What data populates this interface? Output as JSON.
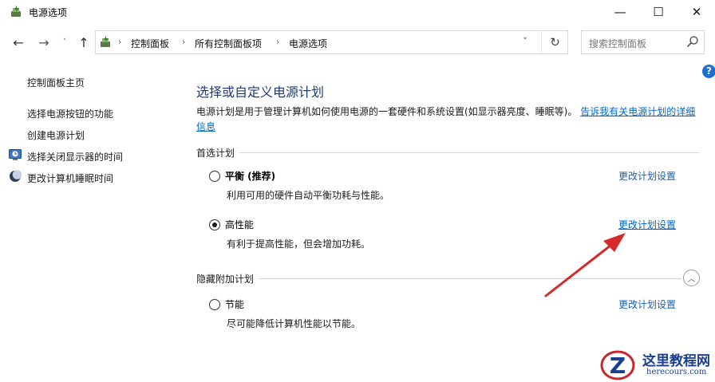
{
  "window": {
    "title": "电源选项",
    "minimize_glyph": "—",
    "maximize_glyph": "☐",
    "close_glyph": "✕"
  },
  "nav": {
    "back_glyph": "←",
    "forward_glyph": "→",
    "recent_glyph": "˅",
    "up_glyph": "↑",
    "breadcrumb": [
      "控制面板",
      "所有控制面板项",
      "电源选项"
    ],
    "dropdown_glyph": "˅",
    "refresh_glyph": "↻"
  },
  "search": {
    "placeholder": "搜索控制面板"
  },
  "help_glyph": "?",
  "sidebar": {
    "home": "控制面板主页",
    "links": [
      "选择电源按钮的功能",
      "创建电源计划",
      "选择关闭显示器的时间",
      "更改计算机睡眠时间"
    ]
  },
  "main": {
    "heading": "选择或自定义电源计划",
    "description": "电源计划是用于管理计算机如何使用电源的一套硬件和系统设置(如显示器亮度、睡眠等)。",
    "description_link": "告诉我有关电源计划的详细信息",
    "preferred_label": "首选计划",
    "hidden_label": "隐藏附加计划",
    "plans": [
      {
        "name": "平衡 (推荐)",
        "desc": "利用可用的硬件自动平衡功耗与性能。",
        "link": "更改计划设置",
        "selected": false
      },
      {
        "name": "高性能",
        "desc": "有利于提高性能，但会增加功耗。",
        "link": "更改计划设置",
        "selected": true
      },
      {
        "name": "节能",
        "desc": "尽可能降低计算机性能以节能。",
        "link": "更改计划设置",
        "selected": false
      }
    ]
  },
  "watermark": {
    "title": "这里教程网",
    "url": "herecours.com"
  },
  "colors": {
    "link": "#0066cc",
    "heading": "#1e3a78",
    "arrow": "#d42a2a",
    "help": "#1f6fd0"
  }
}
